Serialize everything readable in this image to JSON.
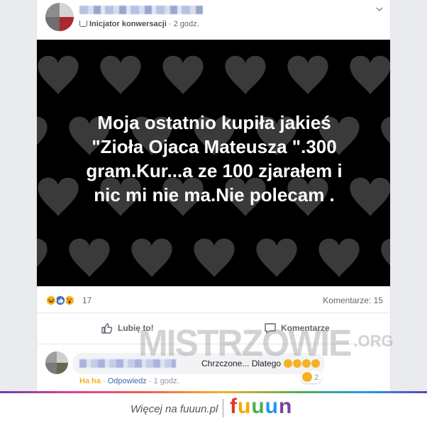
{
  "post": {
    "author_meta": {
      "badge_label": "Inicjator konwersacji",
      "separator": " · ",
      "time": "2 godz."
    },
    "image_text": {
      "lines": [
        "Moja ostatnio kupiła jakieś",
        "\"Zioła Ojaca Mateusza \".300",
        "gram.Kur...a ze 100 zjarałem i",
        "nic mi nie ma.Nie polecam ."
      ]
    },
    "reactions": {
      "icons": [
        "haha-icon",
        "like-icon",
        "wow-icon"
      ],
      "count": "17",
      "comments_label": "Komentarze: 15"
    },
    "actions": {
      "like_label": "Lubię to!",
      "comment_label": "Komentarze"
    }
  },
  "comment": {
    "text": "Chrzczone... Dlatego",
    "links": {
      "haha": "Ha ha",
      "reply": "Odpowiedz",
      "separator": " · ",
      "time": "1 godz."
    },
    "reaction_count": "2"
  },
  "watermark": {
    "text": "MISTRZOWIE",
    "suffix": ".ORG"
  },
  "footer": {
    "text": "Więcej na fuuun.pl",
    "logo_letters": [
      "f",
      "u",
      "u",
      "u",
      "n"
    ],
    "logo_colors": [
      "#e6332a",
      "#f7a600",
      "#4caf50",
      "#2196f3",
      "#7b3fa0"
    ]
  },
  "colors": {
    "haha": "#f7b125",
    "like": "#4267b2",
    "link": "#4267b2",
    "image_bg": "#000000",
    "heart": "#3a3a3a"
  }
}
